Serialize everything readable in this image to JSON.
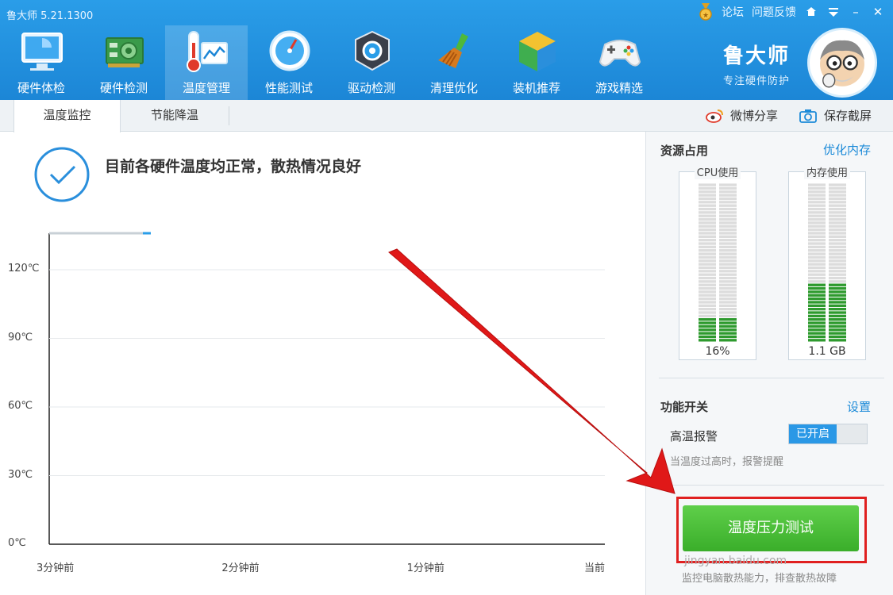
{
  "app": {
    "title": "鲁大师 5.21.1300"
  },
  "top_links": {
    "forum": "论坛",
    "feedback": "问题反馈"
  },
  "window_controls": {
    "skin": "skin-icon",
    "menu": "menu-icon",
    "minimize": "–",
    "close": "✕"
  },
  "nav": {
    "items": [
      {
        "label": "硬件体检",
        "icon": "monitor-icon"
      },
      {
        "label": "硬件检测",
        "icon": "circuit-board-icon"
      },
      {
        "label": "温度管理",
        "icon": "thermometer-icon",
        "active": true
      },
      {
        "label": "性能测试",
        "icon": "speedometer-icon"
      },
      {
        "label": "驱动检测",
        "icon": "driver-gear-icon"
      },
      {
        "label": "清理优化",
        "icon": "broom-icon"
      },
      {
        "label": "装机推荐",
        "icon": "cube-icon"
      },
      {
        "label": "游戏精选",
        "icon": "gamepad-icon"
      }
    ]
  },
  "brand": {
    "name": "鲁大师",
    "slogan": "专注硬件防护"
  },
  "subtabs": {
    "tab1": "温度监控",
    "tab2": "节能降温"
  },
  "share": {
    "weibo": "微博分享",
    "screenshot": "保存截屏"
  },
  "status": {
    "message": "目前各硬件温度均正常，散热情况良好"
  },
  "chart_data": {
    "type": "line",
    "y_ticks": [
      "120℃",
      "90℃",
      "60℃",
      "30℃",
      "0℃"
    ],
    "x_ticks": [
      "3分钟前",
      "2分钟前",
      "1分钟前",
      "当前"
    ],
    "ylim": [
      0,
      120
    ],
    "series": []
  },
  "resources": {
    "title": "资源占用",
    "optimize_link": "优化内存",
    "cpu": {
      "label": "CPU使用",
      "value": "16%",
      "fraction": 0.16
    },
    "memory": {
      "label": "内存使用",
      "value": "1.1 GB",
      "fraction": 0.37
    }
  },
  "switches": {
    "title": "功能开关",
    "settings_link": "设置",
    "high_temp_alarm": {
      "label": "高温报警",
      "state": "已开启"
    },
    "hint": "当温度过高时，报警提醒"
  },
  "bottom": {
    "hint": "监控电脑散热能力，排查散热故障",
    "button": "温度压力测试"
  },
  "watermark": {
    "site": "jingyan.baidu.com"
  },
  "colors": {
    "header": "#1c86d6",
    "accent": "#1b8ad8",
    "gauge_fill": "#2e9a2e",
    "arrow": "#e01818"
  }
}
